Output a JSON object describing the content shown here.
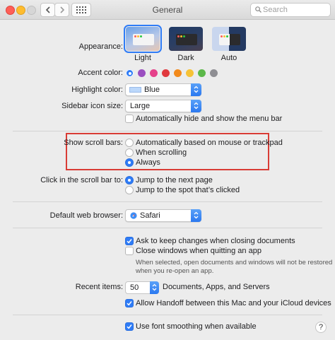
{
  "window": {
    "title": "General"
  },
  "search": {
    "placeholder": "Search"
  },
  "appearance": {
    "label": "Appearance:",
    "options": [
      {
        "label": "Light",
        "selected": true
      },
      {
        "label": "Dark",
        "selected": false
      },
      {
        "label": "Auto",
        "selected": false
      }
    ]
  },
  "accent": {
    "label": "Accent color:",
    "colors": [
      "#2f7cf6",
      "#9b4fc0",
      "#e5418a",
      "#e0393e",
      "#f28a1b",
      "#f6c236",
      "#5cb84a",
      "#8e8e93"
    ],
    "selected_index": 0
  },
  "highlight": {
    "label": "Highlight color:",
    "value": "Blue",
    "swatch": "#bcd8fb"
  },
  "sidebar": {
    "label": "Sidebar icon size:",
    "value": "Large"
  },
  "menubar": {
    "label": "Automatically hide and show the menu bar",
    "checked": false
  },
  "scrollbars": {
    "label": "Show scroll bars:",
    "options": [
      {
        "label": "Automatically based on mouse or trackpad",
        "selected": false
      },
      {
        "label": "When scrolling",
        "selected": false
      },
      {
        "label": "Always",
        "selected": true
      }
    ]
  },
  "click_scroll": {
    "label": "Click in the scroll bar to:",
    "options": [
      {
        "label": "Jump to the next page",
        "selected": true
      },
      {
        "label": "Jump to the spot that’s clicked",
        "selected": false
      }
    ]
  },
  "browser": {
    "label": "Default web browser:",
    "value": "Safari"
  },
  "docs": {
    "ask_changes": {
      "label": "Ask to keep changes when closing documents",
      "checked": true
    },
    "close_windows": {
      "label": "Close windows when quitting an app",
      "checked": false
    },
    "note_line1": "When selected, open documents and windows will not be restored",
    "note_line2": "when you re-open an app."
  },
  "recent": {
    "label": "Recent items:",
    "value": "50",
    "suffix": "Documents, Apps, and Servers"
  },
  "handoff": {
    "label": "Allow Handoff between this Mac and your iCloud devices",
    "checked": true
  },
  "font_smoothing": {
    "label": "Use font smoothing when available",
    "checked": true
  },
  "help": {
    "label": "?"
  }
}
